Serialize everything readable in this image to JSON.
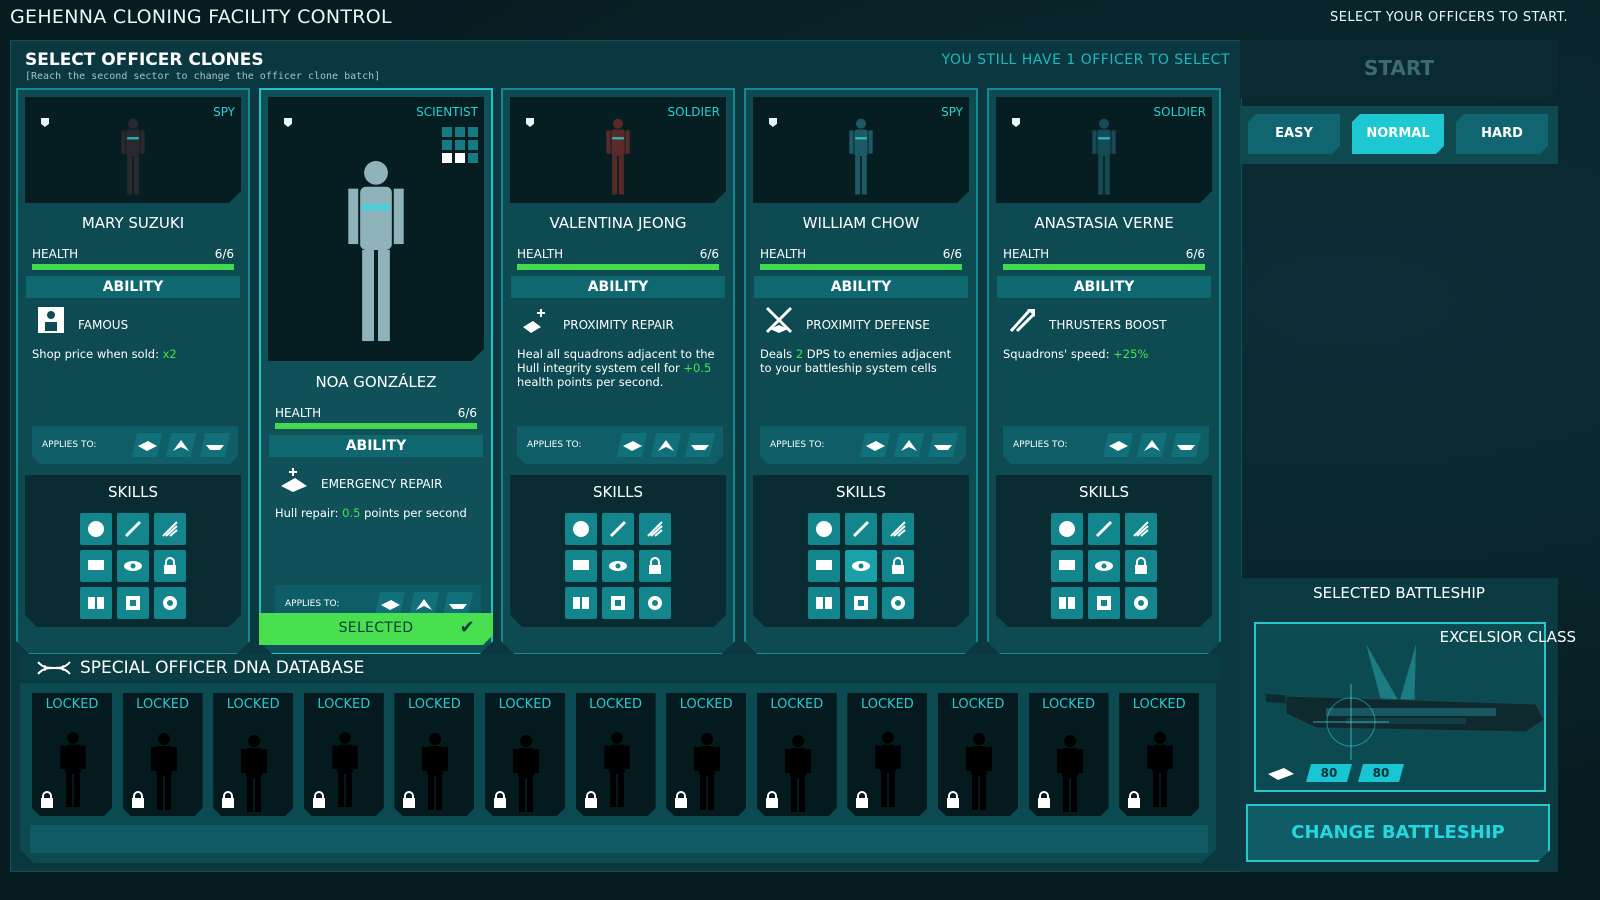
{
  "header": {
    "title": "GEHENNA CLONING FACILITY CONTROL",
    "hint": "SELECT YOUR OFFICERS TO START."
  },
  "selection": {
    "title": "SELECT OFFICER CLONES",
    "subtitle": "[Reach the second sector to change the officer clone batch]",
    "remaining": "YOU STILL HAVE 1 OFFICER TO SELECT"
  },
  "labels": {
    "health": "HEALTH",
    "ability": "ABILITY",
    "applies_to": "APPLIES TO:",
    "skills": "SKILLS",
    "selected": "SELECTED"
  },
  "officers": [
    {
      "class": "SPY",
      "name": "MARY SUZUKI",
      "health": "6/6",
      "health_fraction": 1.0,
      "ability": "FAMOUS",
      "ability_icon": "famous-icon",
      "desc_pre": "Shop price when sold: ",
      "desc_hl": "x2",
      "desc_post": "",
      "selected": false,
      "figure_color": "#2a2a2e"
    },
    {
      "class": "SCIENTIST",
      "name": "NOA GONZÁLEZ",
      "health": "6/6",
      "health_fraction": 1.0,
      "ability": "EMERGENCY REPAIR",
      "ability_icon": "emergency-repair-icon",
      "desc_pre": "Hull repair: ",
      "desc_hl": "0.5",
      "desc_post": " points per second",
      "selected": true,
      "figure_color": "#8fb3bb"
    },
    {
      "class": "SOLDIER",
      "name": "VALENTINA JEONG",
      "health": "6/6",
      "health_fraction": 1.0,
      "ability": "PROXIMITY REPAIR",
      "ability_icon": "proximity-repair-icon",
      "desc_pre": "Heal all squadrons adjacent to the Hull integrity system cell for ",
      "desc_hl": "+0.5",
      "desc_post": " health points per second.",
      "selected": false,
      "figure_color": "#5a2a2a"
    },
    {
      "class": "SPY",
      "name": "WILLIAM CHOW",
      "health": "6/6",
      "health_fraction": 1.0,
      "ability": "PROXIMITY DEFENSE",
      "ability_icon": "proximity-defense-icon",
      "desc_pre": "Deals ",
      "desc_hl": "2",
      "desc_post": " DPS to enemies adjacent to your battleship system cells",
      "selected": false,
      "figure_color": "#1d5a66"
    },
    {
      "class": "SOLDIER",
      "name": "ANASTASIA VERNE",
      "health": "6/6",
      "health_fraction": 1.0,
      "ability": "THRUSTERS BOOST",
      "ability_icon": "thrusters-boost-icon",
      "desc_pre": "Squadrons' speed: ",
      "desc_hl": "+25%",
      "desc_post": "",
      "selected": false,
      "figure_color": "#164a55"
    }
  ],
  "dna": {
    "title": "SPECIAL OFFICER DNA DATABASE",
    "slot_label": "LOCKED",
    "slot_count": 13
  },
  "sidebar": {
    "start": "START",
    "difficulty": [
      "EASY",
      "NORMAL",
      "HARD"
    ],
    "difficulty_active": "NORMAL",
    "ship_title": "SELECTED BATTLESHIP",
    "ship_name": "EXCELSIOR CLASS",
    "ship_stats": [
      "80",
      "80"
    ],
    "change": "CHANGE BATTLESHIP"
  },
  "colors": {
    "accent": "#1ec8d2",
    "health": "#45d94e",
    "selected": "#49e04f"
  }
}
